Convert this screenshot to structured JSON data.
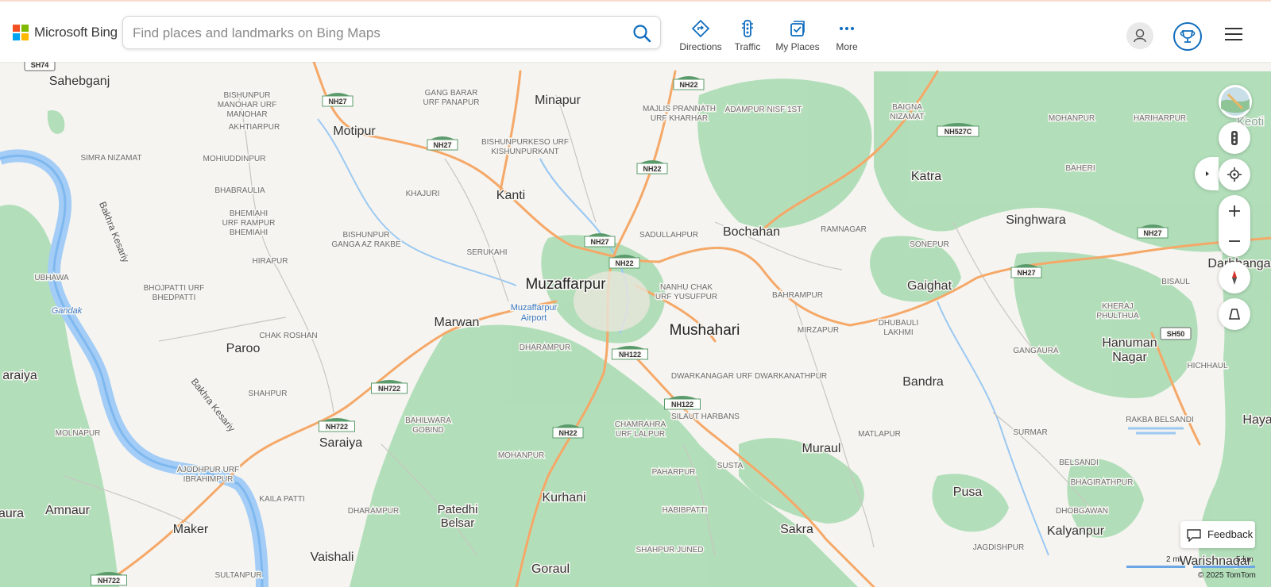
{
  "header": {
    "logo_text": "Microsoft Bing",
    "logo_colors": [
      "#f25022",
      "#7fba00",
      "#00a4ef",
      "#ffb900"
    ],
    "search_placeholder": "Find places and landmarks on Bing Maps",
    "nav": [
      {
        "label": "Directions",
        "icon": "directions-icon"
      },
      {
        "label": "Traffic",
        "icon": "traffic-icon"
      },
      {
        "label": "My Places",
        "icon": "my-places-icon"
      },
      {
        "label": "More",
        "icon": "more-icon"
      }
    ],
    "accent_color": "#0f6cbd"
  },
  "map": {
    "colors": {
      "background": "#f5f4f0",
      "forest": "#a6dbb0",
      "water": "#a3cdf6",
      "road": "#f5a868",
      "shield": "#5b9b6b"
    },
    "cities_large": [
      "Muzaffarpur",
      "Mushahari"
    ],
    "cities": [
      "Sahebganj",
      "Minapur",
      "Motipur",
      "Kanti",
      "Katra",
      "Bochahan",
      "Singhwara",
      "Gaighat",
      "Marwan",
      "Paroo",
      "Saraiya",
      "Bandra",
      "Muraul",
      "Kurhani",
      "Pusa",
      "Kalyanpur",
      "Sakra",
      "Amnaur",
      "Maker",
      "Vaishali",
      "Goraul",
      "Patedhi Belsar",
      "Hanuman Nagar",
      "Darbhanga",
      "Hayagh",
      "araiya",
      "aura",
      "Warishnagar",
      "Keoti"
    ],
    "villages": [
      "BISHUNPUR MANOHAR URF MANOHAR",
      "AKHTIARPUR",
      "GANG BARAR URF PANAPUR",
      "MAJLIS PRANNATH URF KHARHAR",
      "ADAMPUR NISF 1ST",
      "BAIGNA NIZAMAT",
      "MOHANPUR",
      "HARIHARPUR",
      "SIMRA NIZAMAT",
      "MOHIUDDINPUR",
      "BISHUNPURKESO URF KISHUNPURKANT",
      "BAHERI",
      "BHABRAULIA",
      "KHAJURI",
      "BHEMIAHI URF RAMPUR BHEMIAHI",
      "BISHUNPUR GANGA AZ RAKBE",
      "SADULLAHPUR",
      "RAMNAGAR",
      "SONEPUR",
      "SERUKAHI",
      "HIRAPUR",
      "UBHAWA",
      "BHOJPATTI URF BHEDPATTI",
      "NANHU CHAK URF YUSUFPUR",
      "BAHRAMPUR",
      "KHERAJ PHULTHUA",
      "BISAUL",
      "CHAK ROSHAN",
      "DHARAMPUR",
      "MIRZAPUR",
      "DHUBAULI LAKHMI",
      "GANGAURA",
      "HICHHAUL",
      "SHAHPUR",
      "DWARKANAGAR URF DWARKANATHPUR",
      "SILAUT HARBANS",
      "BAHILWARA GOBIND",
      "CHAMRAHRA URF LALPUR",
      "MATLAPUR",
      "SURMAR",
      "RAKBA BELSANDI",
      "MOLNAPUR",
      "AJODHPUR URF IBRAHIMPUR",
      "MOHANPUR",
      "SUSTA",
      "BELSANDI",
      "BHAGIRATHPUR",
      "KAILA PATTI",
      "PAHARPUR",
      "DHOBGAWAN",
      "DHARAMPUR",
      "HABIBPATTI",
      "JAGDISHPUR",
      "SHAHPUR JUNED",
      "SULTANPUR"
    ],
    "highways": [
      "SH74",
      "NH27",
      "NH22",
      "NH527C",
      "NH722",
      "NH122",
      "SH50"
    ],
    "rivers": [
      "Gandak",
      "Bakhra Kesariy"
    ],
    "airport": "Muzaffarpur Airport"
  },
  "controls": [
    "map-style-button",
    "traffic-toggle-button",
    "expand-panel-button",
    "locate-me-button",
    "zoom-in-button",
    "zoom-out-button",
    "compass-button",
    "tilt-button"
  ],
  "feedback_label": "Feedback",
  "scale": {
    "label_1": "2 mi",
    "label_2": "5 km"
  },
  "copyright": "© 2025 TomTom"
}
